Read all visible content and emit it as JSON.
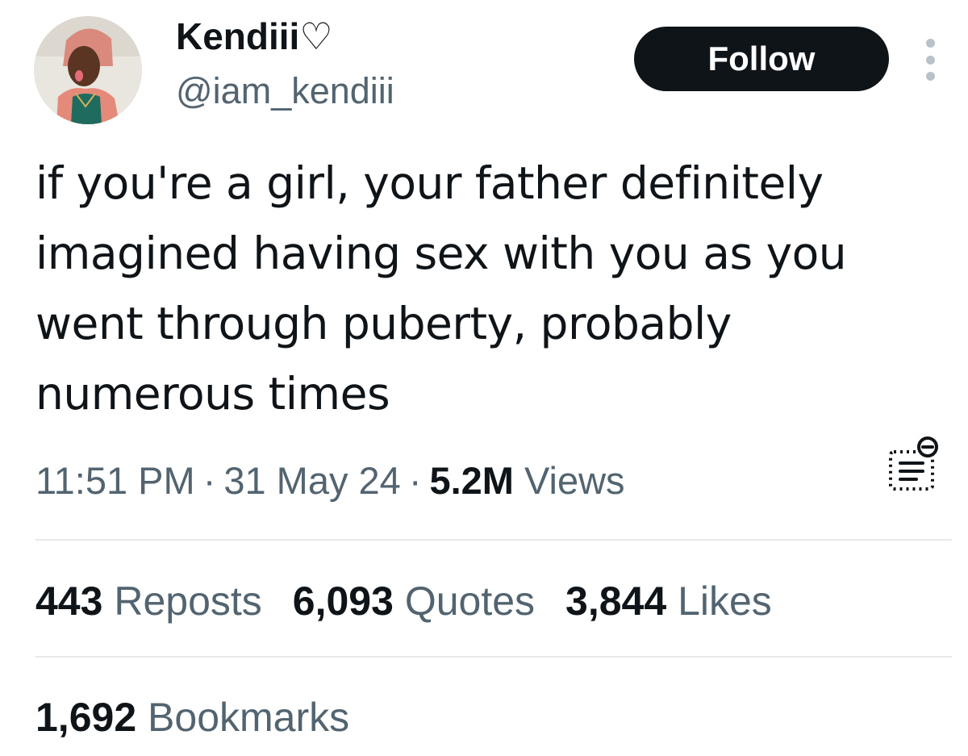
{
  "author": {
    "display_name": "Kendiii♡",
    "handle": "@iam_kendiii",
    "avatar_icon": "profile-photo"
  },
  "actions": {
    "follow_label": "Follow",
    "more_icon": "more-vertical-icon"
  },
  "tweet": {
    "text": "if you're a girl, your father definitely imagined having sex with you as you went through puberty, probably numerous times"
  },
  "meta": {
    "time": "11:51 PM",
    "separator": "·",
    "date": "31 May 24",
    "views_count": "5.2M",
    "views_label": "Views",
    "notes_icon": "community-notes-icon"
  },
  "stats": {
    "reposts_count": "443",
    "reposts_label": "Reposts",
    "quotes_count": "6,093",
    "quotes_label": "Quotes",
    "likes_count": "3,844",
    "likes_label": "Likes",
    "bookmarks_count": "1,692",
    "bookmarks_label": "Bookmarks"
  },
  "colors": {
    "text_primary": "#0f1419",
    "text_secondary": "#536471",
    "divider": "#e6eaed",
    "follow_bg": "#0f1419"
  }
}
